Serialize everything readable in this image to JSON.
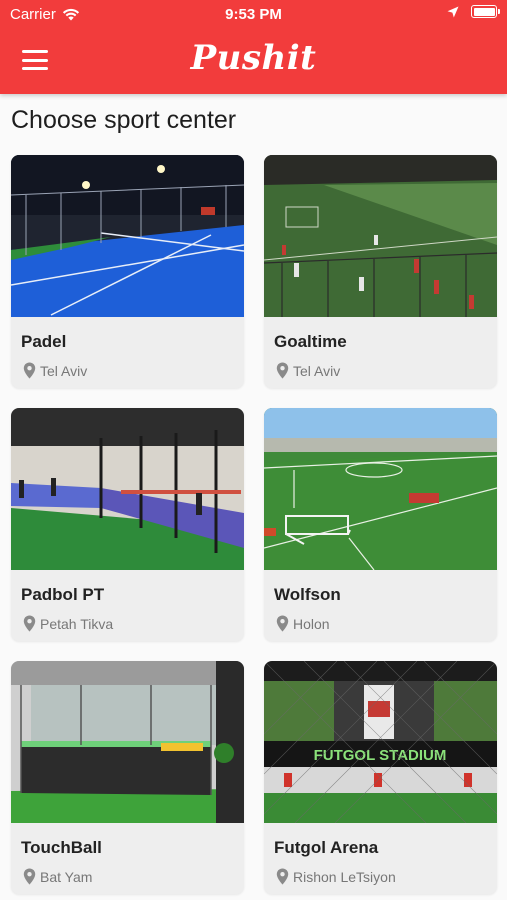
{
  "status_bar": {
    "carrier": "Carrier",
    "time": "9:53 PM"
  },
  "header": {
    "logo": "Pushit",
    "menu_icon": "hamburger-menu-icon"
  },
  "page": {
    "title": "Choose sport center"
  },
  "centers": [
    {
      "name": "Padel",
      "location": "Tel Aviv"
    },
    {
      "name": "Goaltime",
      "location": "Tel Aviv"
    },
    {
      "name": "Padbol PT",
      "location": "Petah Tikva"
    },
    {
      "name": "Wolfson",
      "location": "Holon"
    },
    {
      "name": "TouchBall",
      "location": "Bat Yam"
    },
    {
      "name": "Futgol Arena",
      "location": "Rishon LeTsiyon"
    }
  ],
  "photo_sign_text": "FUTGOL STADIUM",
  "colors": {
    "brand": "#f23c3c",
    "card_bg": "#eeeeee",
    "location_text": "#777777"
  }
}
